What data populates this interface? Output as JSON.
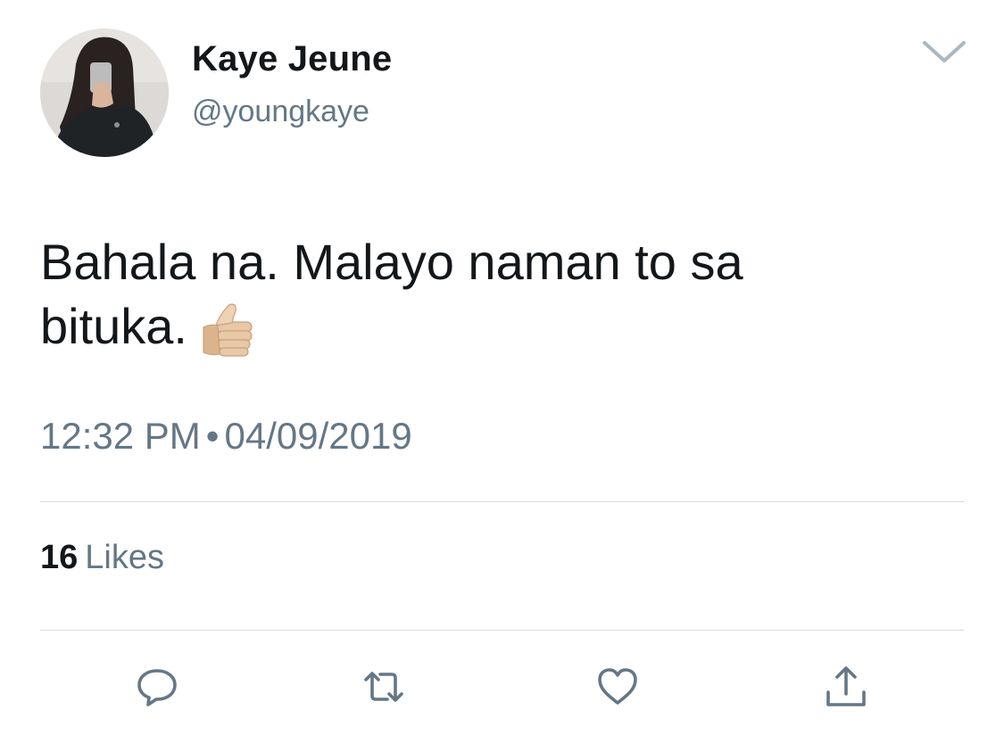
{
  "tweet": {
    "author": {
      "display_name": "Kaye Jeune",
      "handle": "@youngkaye"
    },
    "text_lines": [
      "Bahala na. Malayo naman to sa",
      "bituka."
    ],
    "emoji": "thumbs-up-icon",
    "time": "12:32 PM",
    "separator": "•",
    "date": "04/09/2019",
    "likes": {
      "count": "16",
      "label": "Likes"
    },
    "actions": [
      "reply-icon",
      "retweet-icon",
      "like-heart-icon",
      "share-icon"
    ]
  },
  "colors": {
    "primary_text": "#14171a",
    "secondary_text": "#657786",
    "divider": "#d8dde2",
    "icon": "#657786",
    "chevron": "#aab8c2"
  }
}
